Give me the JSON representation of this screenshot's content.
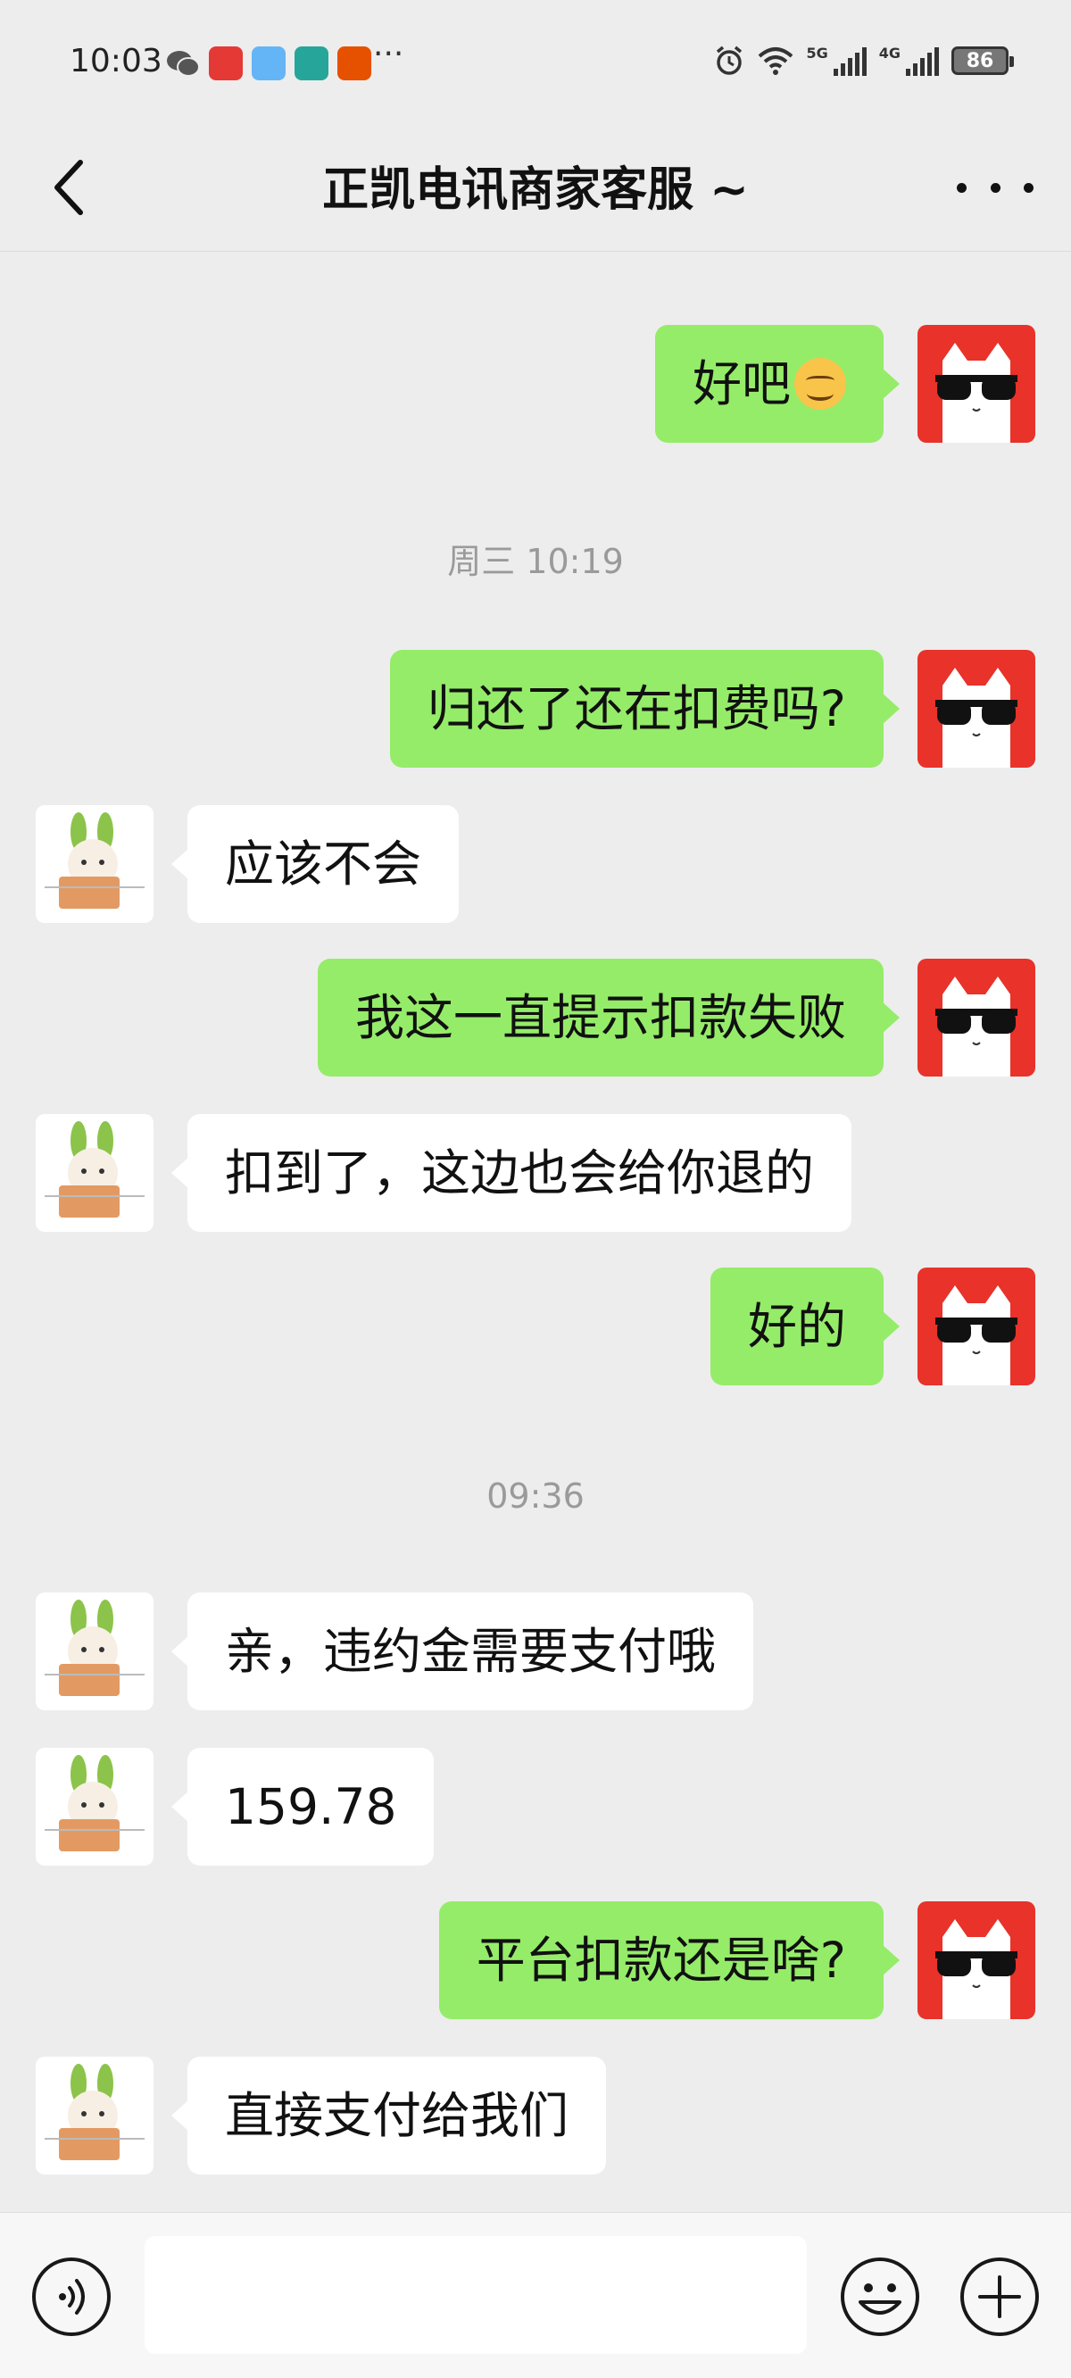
{
  "status_bar": {
    "time": "10:03",
    "battery": "86",
    "net_1": "5G",
    "net_2": "4G"
  },
  "header": {
    "title": "正凯电讯商家客服 ~"
  },
  "messages": [
    {
      "side": "left",
      "text": "",
      "partial": true
    },
    {
      "side": "right",
      "text": "好吧",
      "emoji": "smile"
    },
    {
      "type": "time",
      "text": "周三 10:19"
    },
    {
      "side": "right",
      "text": "归还了还在扣费吗?"
    },
    {
      "side": "left",
      "text": "应该不会"
    },
    {
      "side": "right",
      "text": "我这一直提示扣款失败"
    },
    {
      "side": "left",
      "text": "扣到了，这边也会给你退的"
    },
    {
      "side": "right",
      "text": "好的"
    },
    {
      "type": "time",
      "text": "09:36"
    },
    {
      "side": "left",
      "text": "亲，违约金需要支付哦"
    },
    {
      "side": "left",
      "text": "159.78"
    },
    {
      "side": "right",
      "text": "平台扣款还是啥?"
    },
    {
      "side": "left",
      "text": "直接支付给我们"
    }
  ],
  "input_bar": {
    "placeholder": ""
  },
  "colors": {
    "background": "#ededed",
    "my_bubble": "#95ec69",
    "their_bubble": "#ffffff",
    "my_avatar": "#e8322a"
  },
  "icons": [
    "back-icon",
    "more-icon",
    "voice-icon",
    "emoji-icon",
    "plus-icon"
  ]
}
